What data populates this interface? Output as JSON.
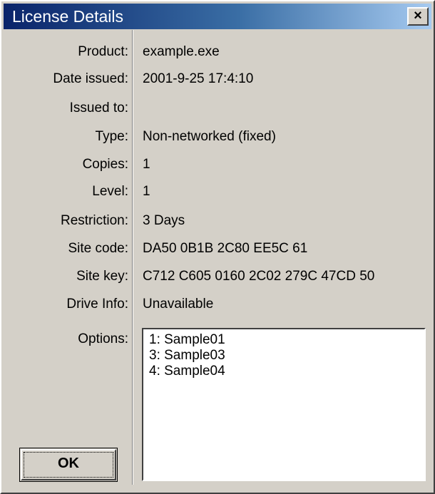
{
  "window": {
    "title": "License Details",
    "close_glyph": "×"
  },
  "fields": [
    {
      "label": "Product:",
      "value": "example.exe"
    },
    {
      "label": "Date issued:",
      "value": "2001-9-25 17:4:10"
    },
    {
      "label": "Issued to:",
      "value": ""
    },
    {
      "label": "Type:",
      "value": "Non-networked (fixed)"
    },
    {
      "label": "Copies:",
      "value": "1"
    },
    {
      "label": "Level:",
      "value": "1"
    },
    {
      "label": "Restriction:",
      "value": "3 Days"
    },
    {
      "label": "Site code:",
      "value": "DA50 0B1B 2C80 EE5C 61"
    },
    {
      "label": "Site key:",
      "value": "C712 C605 0160 2C02 279C 47CD 50"
    },
    {
      "label": "Drive Info:",
      "value": "Unavailable"
    }
  ],
  "options": {
    "label": "Options:",
    "items": [
      "1: Sample01",
      "3: Sample03",
      "4: Sample04"
    ]
  },
  "buttons": {
    "ok_label": "OK"
  }
}
